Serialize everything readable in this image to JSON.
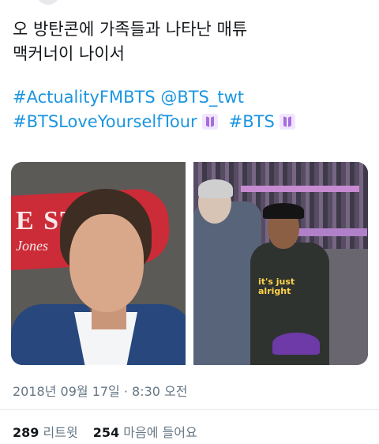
{
  "tweet": {
    "text_line1": "오 방탄콘에 가족들과 나타난 매튜",
    "text_line2": "맥커너이 나이서",
    "hashtag_line1": "#ActualityFMBTS @BTS_twt",
    "hashtag_bts_love": "#BTSLoveYourselfTour",
    "hashtag_bts": "#BTS",
    "icon": "bts-logo-icon",
    "accent_color": "#1b95e0"
  },
  "media": {
    "left_sign_text": "E STA",
    "left_sign_text2": "Jones",
    "right_shirt_text": "it's just\nalright"
  },
  "meta": {
    "timestamp": "2018년 09월 17일 · 8:30 오전"
  },
  "stats": {
    "retweets_count": "289",
    "retweets_label": "리트윗",
    "likes_count": "254",
    "likes_label": "마음에 들어요"
  }
}
